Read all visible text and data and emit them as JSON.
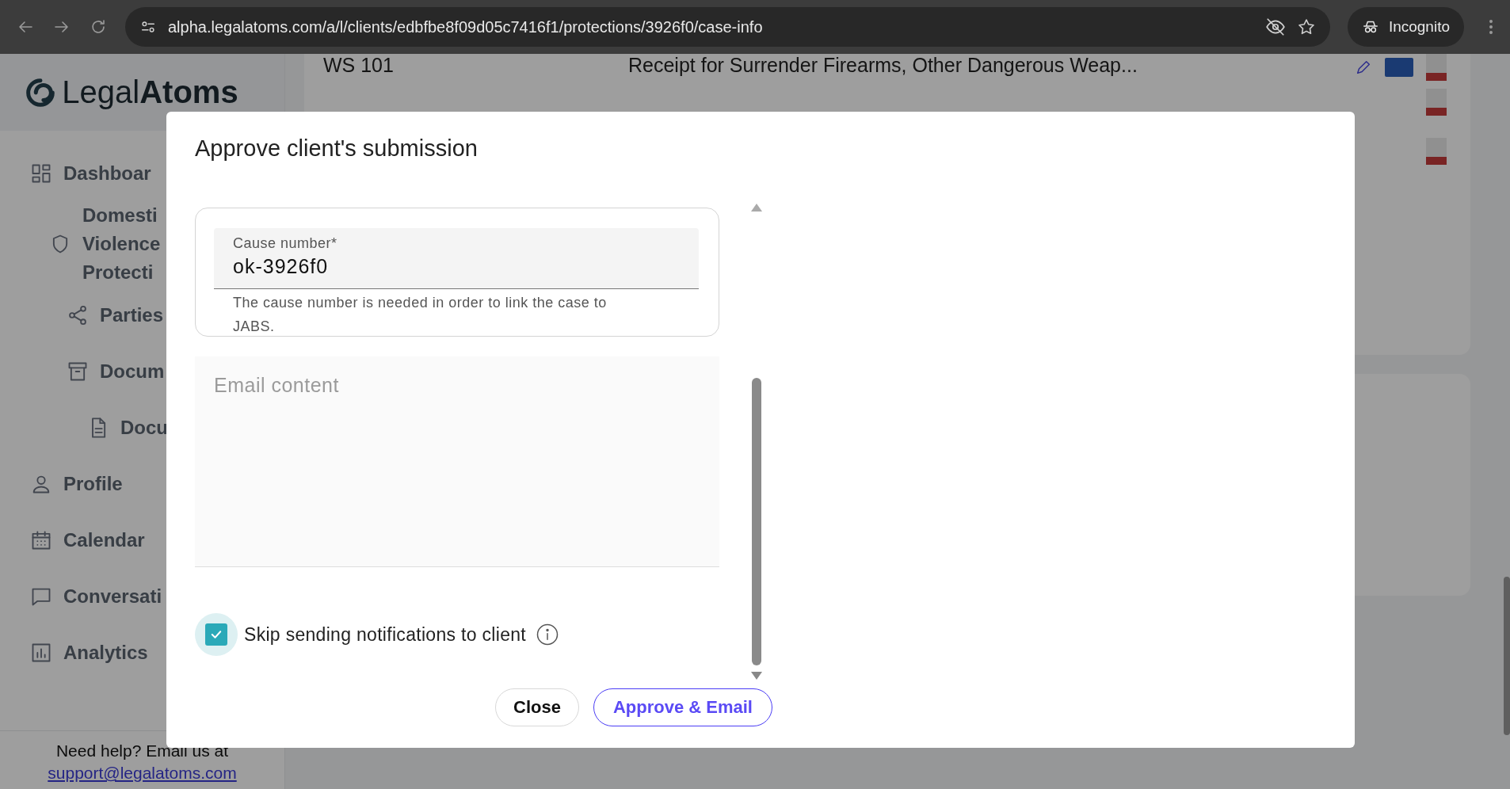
{
  "browser": {
    "url": "alpha.legalatoms.com/a/l/clients/edbfbe8f09d05c7416f1/protections/3926f0/case-info",
    "profile": "Incognito"
  },
  "sidebar": {
    "logo": {
      "light": "Legal",
      "bold": "Atoms"
    },
    "items": [
      {
        "label": "Dashboar",
        "children": [
          {
            "label": "Domesti\nViolence\nProtecti",
            "children": [
              {
                "label": "Parties"
              },
              {
                "label": "Docum",
                "children": [
                  {
                    "label": "Docu"
                  }
                ]
              }
            ]
          }
        ]
      },
      {
        "label": "Profile"
      },
      {
        "label": "Calendar"
      },
      {
        "label": "Conversati"
      },
      {
        "label": "Analytics"
      }
    ],
    "help": "Need help? Email us at",
    "email": "support@legalatoms.com"
  },
  "documents": [
    {
      "name": "WS 101",
      "title": "Receipt for Surrender Firearms, Other Dangerous Weap..."
    }
  ],
  "modal": {
    "title": "Approve client's submission",
    "cause_number": {
      "label": "Cause number*",
      "value": "ok-3926f0",
      "helper": "The cause number is needed in order to link the case to JABS."
    },
    "email": {
      "placeholder": "Email content"
    },
    "skip_notifications": {
      "label": "Skip sending notifications to client",
      "checked": true
    },
    "buttons": [
      {
        "label": "Close",
        "kind": "default"
      },
      {
        "label": "Approve & Email",
        "kind": "primary"
      }
    ]
  }
}
